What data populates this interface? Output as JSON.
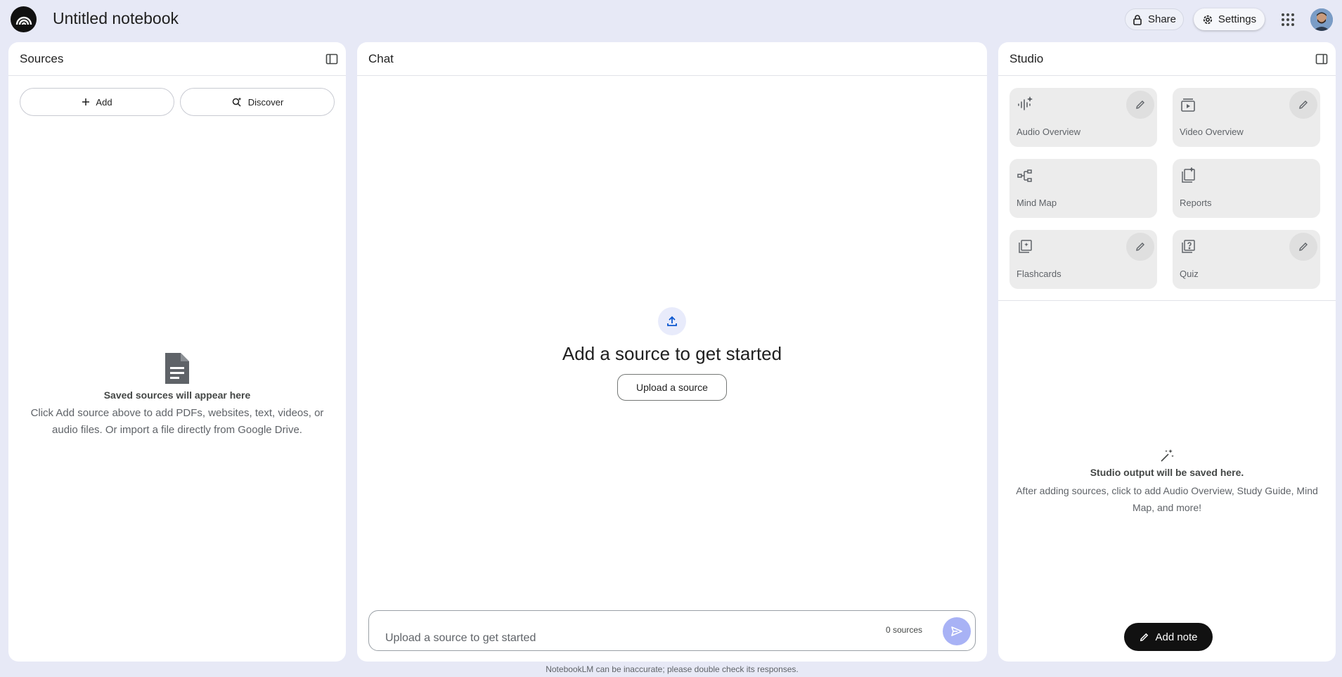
{
  "header": {
    "notebook_title": "Untitled notebook",
    "share_label": "Share",
    "settings_label": "Settings"
  },
  "sources": {
    "title": "Sources",
    "add_label": "Add",
    "discover_label": "Discover",
    "empty_title": "Saved sources will appear here",
    "empty_desc": "Click Add source above to add PDFs, websites, text, videos, or audio files. Or import a file directly from Google Drive."
  },
  "chat": {
    "title": "Chat",
    "heading": "Add a source to get started",
    "upload_label": "Upload a source",
    "input_placeholder": "Upload a source to get started",
    "source_count": "0 sources",
    "disclaimer": "NotebookLM can be inaccurate; please double check its responses."
  },
  "studio": {
    "title": "Studio",
    "tiles": [
      {
        "label": "Audio Overview",
        "icon": "audio-waveform-icon",
        "editable": true
      },
      {
        "label": "Video Overview",
        "icon": "video-overview-icon",
        "editable": true
      },
      {
        "label": "Mind Map",
        "icon": "mind-map-icon",
        "editable": false
      },
      {
        "label": "Reports",
        "icon": "reports-icon",
        "editable": false
      },
      {
        "label": "Flashcards",
        "icon": "flashcards-icon",
        "editable": true
      },
      {
        "label": "Quiz",
        "icon": "quiz-icon",
        "editable": true
      }
    ],
    "empty_title": "Studio output will be saved here.",
    "empty_desc": "After adding sources, click to add Audio Overview, Study Guide, Mind Map, and more!",
    "add_note_label": "Add note"
  },
  "colors": {
    "background": "#e7e9f6",
    "panel": "#ffffff",
    "tile": "#ececec",
    "send_button": "#a8b2f5",
    "add_note": "#111111"
  }
}
